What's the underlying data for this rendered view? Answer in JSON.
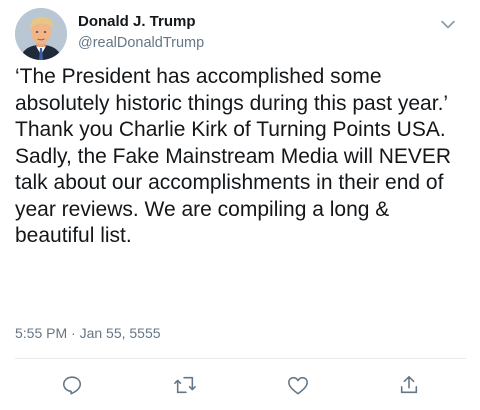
{
  "tweet": {
    "author": {
      "display_name": "Donald J. Trump",
      "handle": "@realDonaldTrump",
      "avatar_icon": "profile-photo"
    },
    "text": "‘The President has accomplished some absolutely historic things during this past year.’ Thank you Charlie Kirk of Turning Points USA. Sadly, the Fake Mainstream Media will NEVER talk about our accomplishments in their end of year reviews. We are compiling a long & beautiful list.",
    "timestamp": "5:55 PM · Jan 55, 5555",
    "menu_icon": "chevron-down-icon",
    "actions": [
      {
        "name": "reply",
        "icon": "reply-icon"
      },
      {
        "name": "retweet",
        "icon": "retweet-icon"
      },
      {
        "name": "like",
        "icon": "heart-icon"
      },
      {
        "name": "share",
        "icon": "share-icon"
      }
    ]
  },
  "colors": {
    "primary_text": "#14171a",
    "secondary_text": "#657786",
    "icon": "#657786",
    "divider": "#e6ecf0",
    "background": "#ffffff"
  }
}
